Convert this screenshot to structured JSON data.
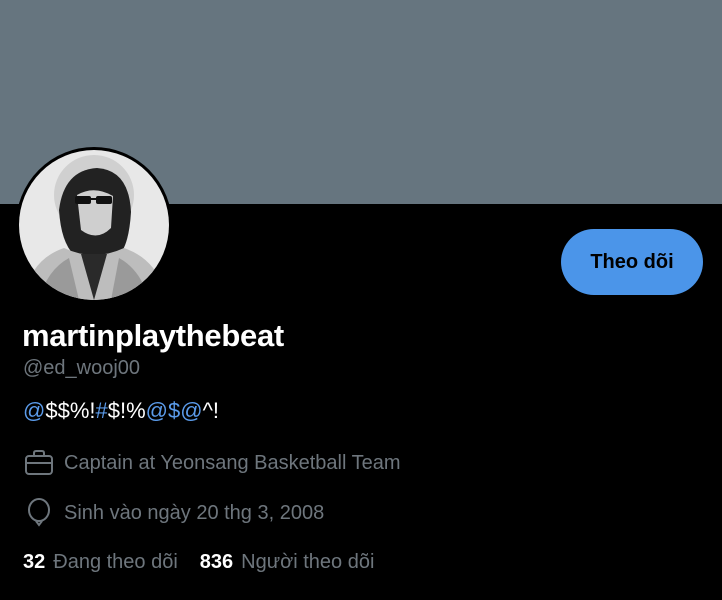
{
  "colors": {
    "banner": "#66757f",
    "background": "#000000",
    "accent": "#4b95e9",
    "link": "#5b9bea",
    "secondary_text": "#6e767d"
  },
  "profile": {
    "display_name": "martinplaythebeat",
    "handle": "@ed_wooj00",
    "bio_parts": [
      "@",
      "$$%!",
      "#",
      "$!%",
      "@",
      "$",
      "@",
      "^!"
    ],
    "job": "Captain at Yeonsang Basketball Team",
    "job_icon": "briefcase-icon",
    "birthday": "Sinh vào ngày 20 thg 3, 2008",
    "birthday_icon": "balloon-icon"
  },
  "actions": {
    "follow_label": "Theo dõi"
  },
  "stats": {
    "following_count": "32",
    "following_label": "Đang theo dõi",
    "followers_count": "836",
    "followers_label": "Người theo dõi"
  }
}
